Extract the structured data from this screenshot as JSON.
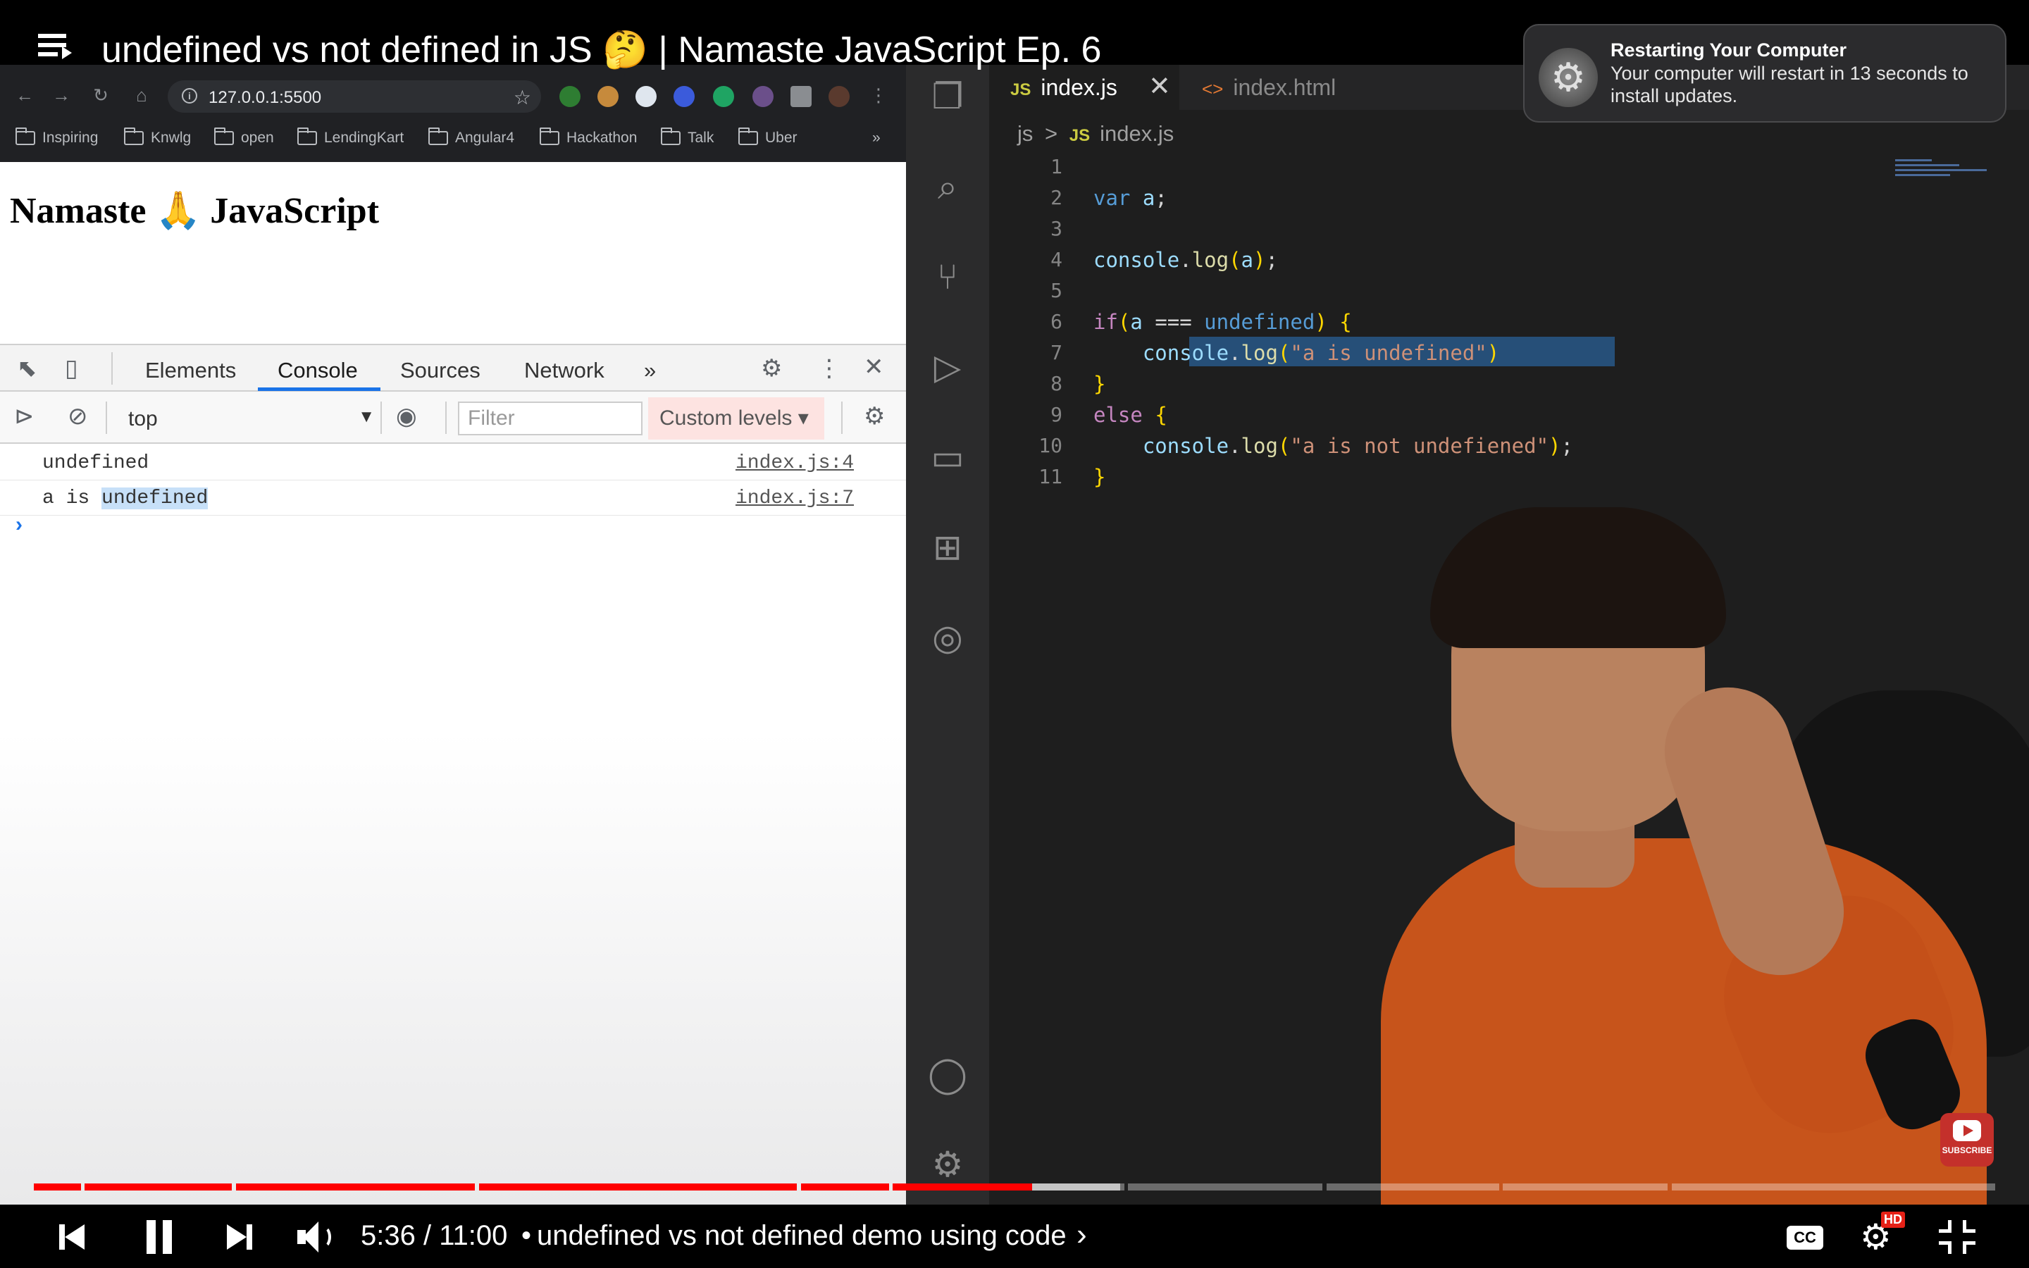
{
  "video": {
    "title": "undefined vs not defined in JS 🤔 | Namaste JavaScript Ep. 6"
  },
  "notification": {
    "title": "Restarting Your Computer",
    "body": "Your computer will restart in 13 seconds to install updates."
  },
  "browser": {
    "url": "127.0.0.1:5500",
    "bookmarks": [
      "Inspiring",
      "Knwlg",
      "open",
      "LendingKart",
      "Angular4",
      "Hackathon",
      "Talk",
      "Uber"
    ],
    "bookmarks_more": "»",
    "page_heading": "Namaste 🙏 JavaScript"
  },
  "devtools": {
    "tabs": [
      "Elements",
      "Console",
      "Sources",
      "Network"
    ],
    "active_tab": "Console",
    "tabs_more": "»",
    "context": "top",
    "filter_placeholder": "Filter",
    "levels": "Custom levels ▾",
    "logs": [
      {
        "text": "undefined",
        "source": "index.js:4"
      },
      {
        "text_prefix": "a is ",
        "text_highlight": "undefined",
        "source": "index.js:7"
      }
    ],
    "prompt": "›"
  },
  "editor": {
    "tabs": [
      {
        "badge": "JS",
        "label": "index.js",
        "active": true
      },
      {
        "badge": "<>",
        "label": "index.html",
        "active": false
      }
    ],
    "breadcrumb": {
      "folder": "js",
      "sep": ">",
      "badge": "JS",
      "file": "index.js"
    },
    "line_numbers": [
      "1",
      "2",
      "3",
      "4",
      "5",
      "6",
      "7",
      "8",
      "9",
      "10",
      "11"
    ],
    "selected_line": 7
  },
  "controls": {
    "time": "5:36 / 11:00",
    "separator": "•",
    "chapter": "undefined vs not defined demo using code",
    "chapter_chevron": "›",
    "cc": "CC",
    "hd": "HD",
    "progress_fraction": 0.509
  },
  "subscribe": {
    "label": "SUBSCRIBE"
  },
  "colors": {
    "progress_red": "#ff0000",
    "editor_bg": "#1e1e1e",
    "selection": "#264f78",
    "notification_bg": "#2b2b2d"
  },
  "icons": [
    "playlist-icon",
    "back-icon",
    "forward-icon",
    "reload-icon",
    "home-icon",
    "lock-icon",
    "star-icon",
    "folder-icon",
    "inspect-icon",
    "device-icon",
    "gear-icon",
    "kebab-icon",
    "close-icon",
    "sidebar-icon",
    "clear-icon",
    "eye-icon",
    "explorer-icon",
    "search-icon",
    "source-control-icon",
    "run-debug-icon",
    "remote-icon",
    "extensions-icon",
    "git-graph-icon",
    "account-icon",
    "manage-icon",
    "prev-icon",
    "pause-icon",
    "next-icon",
    "volume-icon",
    "cc-icon",
    "settings-icon",
    "fullscreen-exit-icon"
  ]
}
